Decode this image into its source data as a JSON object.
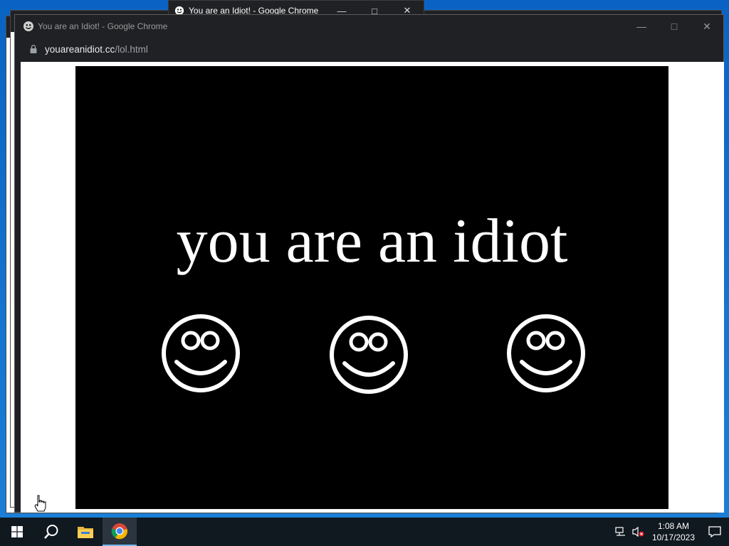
{
  "background_windows": {
    "top_title": "You are an Idiot! - Google Chrome"
  },
  "window": {
    "title": "You are an Idiot! - Google Chrome",
    "url_host": "youareanidiot.cc",
    "url_path": "/lol.html"
  },
  "page": {
    "headline": "you are an idiot",
    "smiley_count": 3
  },
  "taskbar": {
    "pinned": [
      "start-button",
      "search",
      "file-explorer",
      "google-chrome"
    ],
    "active": "google-chrome",
    "time": "1:08 AM",
    "date": "10/17/2023"
  },
  "colors": {
    "chrome_dark": "#202124",
    "page_bg": "#000000",
    "headline": "#ffffff",
    "taskbar": "#101820",
    "desktop": "#0a63c4"
  }
}
